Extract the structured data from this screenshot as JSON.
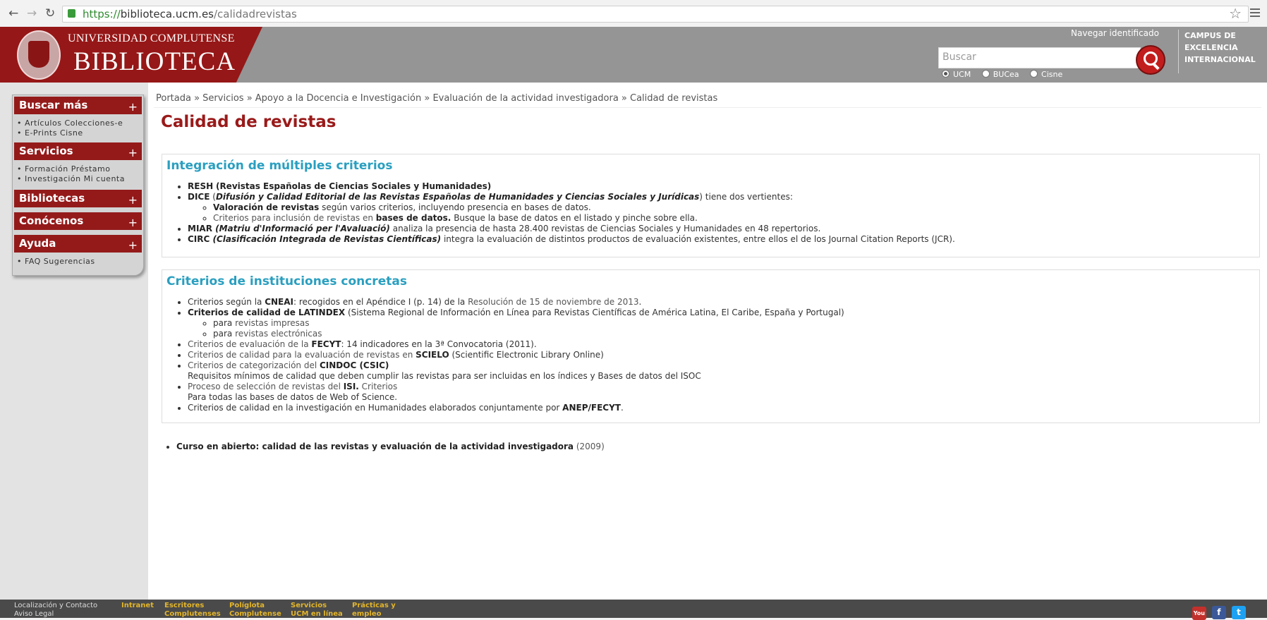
{
  "browser": {
    "url_scheme": "https://",
    "url_host": "biblioteca.ucm.es",
    "url_path": "/calidadrevistas"
  },
  "header": {
    "university": "UNIVERSIDAD COMPLUTENSE",
    "library": "BIBLIOTECA",
    "navegar": "Navegar identificado",
    "search_placeholder": "Buscar",
    "radios": [
      "UCM",
      "BUCea",
      "Cisne"
    ],
    "campus": [
      "CAMPUS DE",
      "EXCELENCIA",
      "INTERNACIONAL"
    ]
  },
  "sidebar": {
    "sections": [
      {
        "title": "Buscar más",
        "links1": "Artículos  Colecciones-e",
        "links2": "E-Prints  Cisne"
      },
      {
        "title": "Servicios",
        "links1": "Formación  Préstamo",
        "links2": "Investigación  Mi cuenta"
      },
      {
        "title": "Bibliotecas"
      },
      {
        "title": "Conócenos"
      },
      {
        "title": "Ayuda",
        "links1": "FAQ  Sugerencias"
      }
    ]
  },
  "breadcrumb": "Portada » Servicios » Apoyo a la Docencia e Investigación  » Evaluación de la actividad investigadora » Calidad de revistas",
  "page_title": "Calidad de revistas",
  "box1": {
    "heading": "Integración de múltiples criterios",
    "resh_link": "RESH",
    "resh_name": "(Revistas Españolas de Ciencias Sociales y Humanidades)",
    "dice_link": "DICE",
    "dice_open": " (",
    "dice_name": "Difusión y Calidad Editorial de las Revistas Españolas de Humanidades y Ciencias Sociales y Jurídicas",
    "dice_rest": ") tiene dos vertientes:",
    "dice_sub1_b": "Valoración de revistas",
    "dice_sub1_rest": " según varios criterios, incluyendo presencia en bases de datos.",
    "dice_sub2_a": "Criterios para inclusión de revistas en ",
    "dice_sub2_b": "bases de datos.",
    "dice_sub2_rest": " Busque la base de datos en el listado y pinche sobre ella.",
    "miar_link": "MIAR",
    "miar_name": " (Matriu d'Informació per l'Avaluació)",
    "miar_rest": " analiza la presencia de hasta 28.400 revistas de Ciencias Sociales y Humanidades en 48 repertorios.",
    "circ_link": "CIRC",
    "circ_name": " (Clasificación Integrada de Revistas Científicas)",
    "circ_rest": " integra la evaluación de distintos productos de evaluación existentes, entre ellos el de los Journal Citation Reports (JCR)."
  },
  "box2": {
    "heading": "Criterios de instituciones concretas",
    "i1_a": "Criterios según la ",
    "i1_b": "CNEAI",
    "i1_c": ": recogidos en el Apéndice I (p. 14) de la ",
    "i1_link": "Resolución de 15 de noviembre de 2013",
    "i1_end": ".",
    "i2_b": "Criterios de calidad de ",
    "i2_link": "LATINDEX",
    "i2_rest": " (Sistema Regional de Información en Línea para Revistas Científicas de América Latina, El Caribe, España y Portugal)",
    "i2_sub1_a": "para ",
    "i2_sub1_link": "revistas impresas",
    "i2_sub2_a": "para ",
    "i2_sub2_link": "revistas electrónicas",
    "i3_link": "Criterios de evaluación de la ",
    "i3_b": "FECYT",
    "i3_rest": ": 14 indicadores en la 3ª Convocatoria (2011).",
    "i4_link": "Criterios de calidad para la evaluación de revistas en ",
    "i4_b": "SCIELO",
    "i4_rest": " (Scientific Electronic Library Online)",
    "i5_link": "Criterios de categorización del ",
    "i5_b": "CINDOC (CSIC)",
    "i5_line2": "Requisitos mínimos de calidad que deben cumplir las revistas para ser incluidas en los índices y Bases de datos del ISOC",
    "i6_link": "Proceso de selección de revistas del ",
    "i6_b": "ISI.",
    "i6_link2": " Criterios",
    "i6_line2": "Para todas las bases de datos de Web of Science.",
    "i7_a": "Criterios de calidad en la investigación en Humanidades elaborados conjuntamente por ",
    "i7_b": "ANEP/FECYT",
    "i7_end": "."
  },
  "course": {
    "link": "Curso en abierto: calidad de las revistas y evaluación de la actividad investigadora",
    "year": " (2009)"
  },
  "footer": {
    "loc": "Localización y Contacto",
    "aviso": "Aviso Legal",
    "intranet": "Intranet",
    "escritores": "Escritores\nComplutenses",
    "poliglota": "Políglota\nComplutense",
    "servicios": "Servicios\nUCM en línea",
    "practicas": "Prácticas y\nempleo",
    "social": [
      "You",
      "f",
      "t"
    ]
  },
  "colors": {
    "brand_red": "#961717",
    "heading_blue": "#2a9fc0",
    "footer_gold": "#e3b52a"
  }
}
